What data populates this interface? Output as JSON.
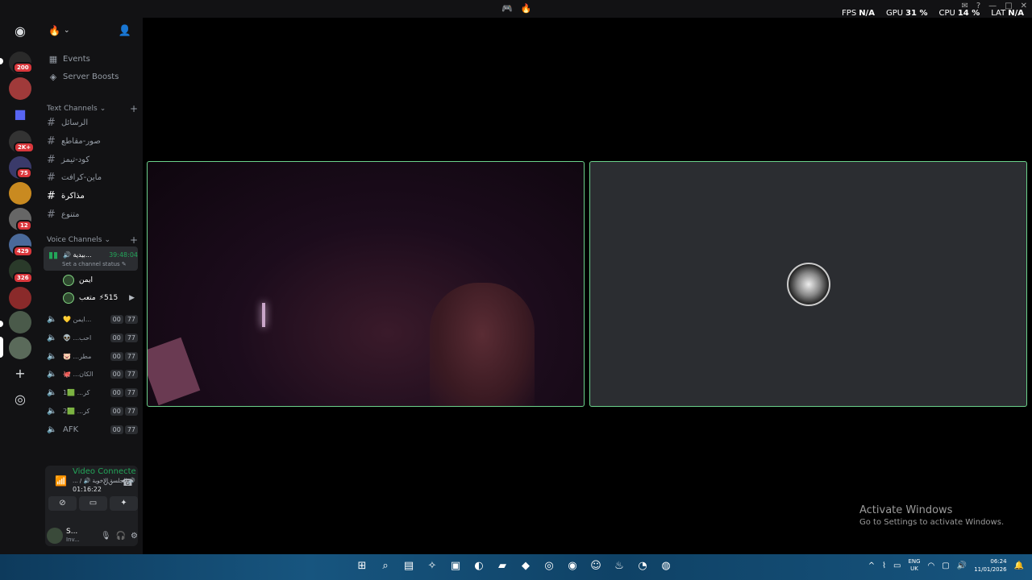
{
  "topbar": {
    "stats": [
      {
        "label": "FPS",
        "value": "N/A"
      },
      {
        "label": "GPU",
        "value": "31 %"
      },
      {
        "label": "CPU",
        "value": "14 %"
      },
      {
        "label": "LAT",
        "value": "N/A"
      }
    ]
  },
  "server_badges": [
    "200",
    "2K+",
    "75",
    "12",
    "429",
    "326"
  ],
  "sidebar": {
    "server_name": "🔥",
    "links": [
      {
        "label": "Events",
        "icon": "calendar-icon"
      },
      {
        "label": "Server Boosts",
        "icon": "boost-icon"
      }
    ],
    "text_category": "Text Channels",
    "text_channels": [
      "الرسائل",
      "صور-مقاطع",
      "كود-تيمز",
      "ماين-كرافت",
      "مذاكرة",
      "متنوع"
    ],
    "voice_category": "Voice Channels",
    "active_voice": {
      "name": "🔊 بيدية...",
      "timer": "39:48:04",
      "status_text": "Set a channel status"
    },
    "voice_users": [
      {
        "name": "ايمن"
      },
      {
        "name": "متعب",
        "extra": "515"
      }
    ],
    "voice_channels": [
      {
        "name": "💛 ايمن...",
        "c1": "00",
        "c2": "77"
      },
      {
        "name": "👽 ...احب",
        "c1": "00",
        "c2": "77"
      },
      {
        "name": "🐷 ...مطر",
        "c1": "00",
        "c2": "77"
      },
      {
        "name": "🐙 ...الكان",
        "c1": "00",
        "c2": "77"
      },
      {
        "name": "1🟩 ...كر",
        "c1": "00",
        "c2": "77"
      },
      {
        "name": "2🟩 ...كر",
        "c1": "00",
        "c2": "77"
      },
      {
        "name": "AFK",
        "c1": "00",
        "c2": "77"
      }
    ]
  },
  "voice_panel": {
    "status": "Video Connecte",
    "sub": "... / 🔊 الجلسة الاخوية 🔊",
    "timer": "01:16:22"
  },
  "user": {
    "name": "S...",
    "status": "Inv..."
  },
  "activate": {
    "title": "Activate Windows",
    "subtitle": "Go to Settings to activate Windows."
  },
  "tray": {
    "lang_top": "ENG",
    "lang_bottom": "UK",
    "time": "06:24",
    "date": "11/01/2026"
  }
}
